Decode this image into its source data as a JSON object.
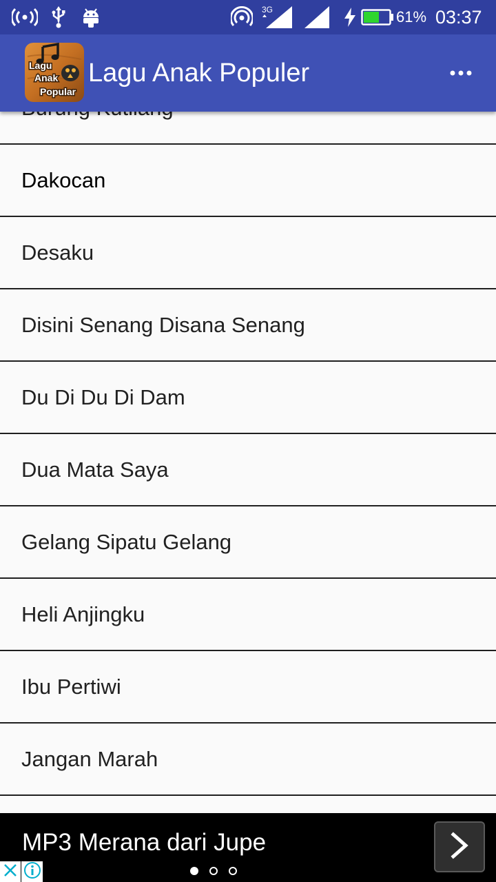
{
  "status_bar": {
    "network_label": "3G",
    "battery_percent": "61%",
    "battery_level": 0.61,
    "time": "03:37",
    "icons": [
      "broadcast-icon",
      "usb-icon",
      "android-icon",
      "hotspot-icon",
      "signal-icon",
      "signal-icon",
      "charging-icon",
      "battery-icon"
    ]
  },
  "app_bar": {
    "title": "Lagu Anak Populer",
    "logo_text": [
      "Lagu",
      "Anak",
      "Popular"
    ],
    "menu_icon": "overflow-menu-icon"
  },
  "songs": [
    "Burung Kutilang",
    "Dakocan",
    "Desaku",
    "Disini Senang Disana Senang",
    "Du Di Du Di Dam",
    "Dua Mata Saya",
    "Gelang Sipatu Gelang",
    "Heli Anjingku",
    "Ibu Pertiwi",
    "Jangan Marah",
    ""
  ],
  "ad": {
    "text": "MP3 Merana dari Jupe",
    "next_icon": "chevron-right-icon",
    "close_icon": "close-icon",
    "info_icon": "info-icon",
    "page_count": 3,
    "active_page": 1
  },
  "colors": {
    "status_bar": "#303f9f",
    "app_bar": "#3f51b5",
    "list_background": "#fafafa",
    "divider": "#1f1f1f",
    "ad_background": "#000000",
    "ad_icon": "#00aecd"
  }
}
